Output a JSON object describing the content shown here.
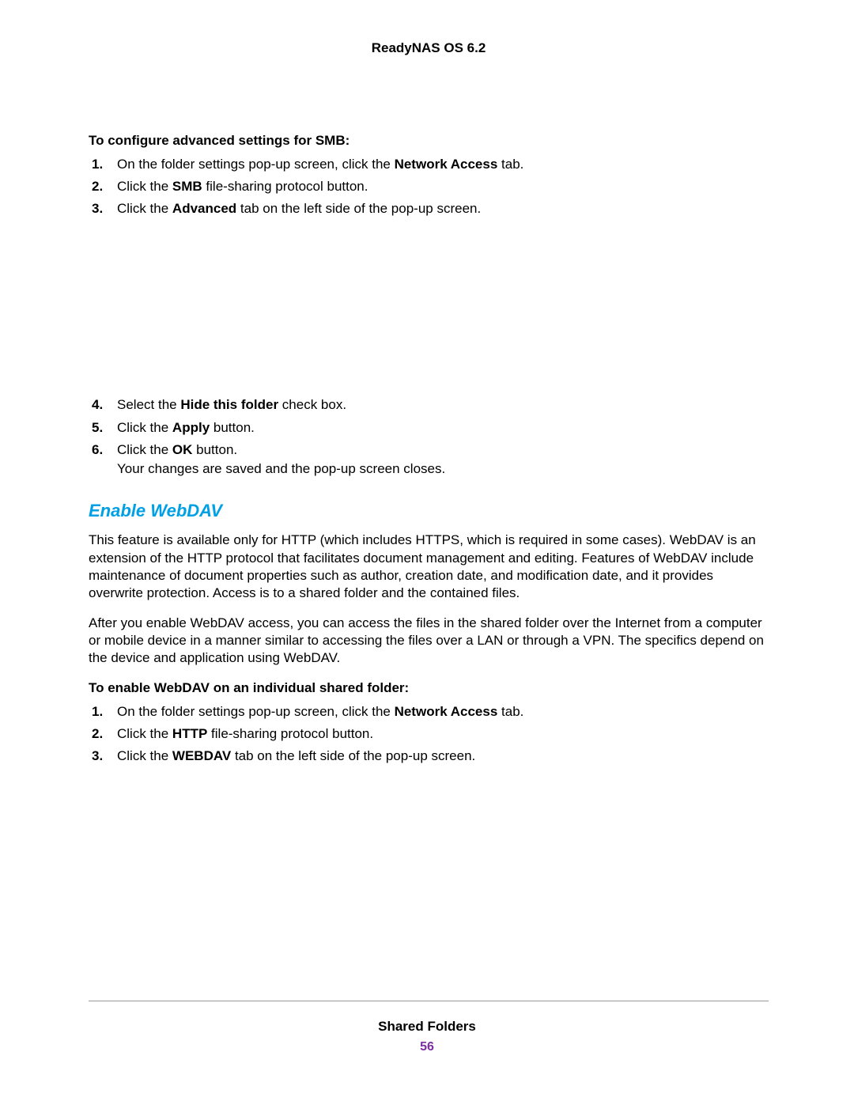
{
  "header": {
    "title": "ReadyNAS OS 6.2"
  },
  "section1": {
    "lead": "To configure advanced settings for SMB:",
    "items_a": [
      {
        "num": "1.",
        "pre": "On the folder settings pop-up screen, click the ",
        "bold": "Network Access",
        "post": " tab."
      },
      {
        "num": "2.",
        "pre": "Click the ",
        "bold": "SMB",
        "post": " file-sharing protocol button."
      },
      {
        "num": "3.",
        "pre": "Click the ",
        "bold": "Advanced",
        "post": " tab on the left side of the pop-up screen."
      }
    ],
    "items_b": [
      {
        "num": "4.",
        "pre": "Select the ",
        "bold": "Hide this folder",
        "post": " check box."
      },
      {
        "num": "5.",
        "pre": "Click the ",
        "bold": "Apply",
        "post": " button."
      },
      {
        "num": "6.",
        "pre": "Click the ",
        "bold": "OK",
        "post": " button.",
        "sub": "Your changes are saved and the pop-up screen closes."
      }
    ]
  },
  "section2": {
    "heading": "Enable WebDAV",
    "para1": "This feature is available only for HTTP (which includes HTTPS, which is required in some cases). WebDAV is an extension of the HTTP protocol that facilitates document management and editing. Features of WebDAV include maintenance of document properties such as author, creation date, and modification date, and it provides overwrite protection. Access is to a shared folder and the contained files.",
    "para2": "After you enable WebDAV access, you can access the files in the shared folder over the Internet from a computer or mobile device in a manner similar to accessing the files over a LAN or through a VPN. The specifics depend on the device and application using WebDAV.",
    "lead": "To enable WebDAV on an individual shared folder:",
    "items": [
      {
        "num": "1.",
        "pre": "On the folder settings pop-up screen, click the ",
        "bold": "Network Access",
        "post": " tab."
      },
      {
        "num": "2.",
        "pre": "Click the ",
        "bold": "HTTP",
        "post": " file-sharing protocol button."
      },
      {
        "num": "3.",
        "pre": "Click the ",
        "bold": "WEBDAV",
        "post": " tab on the left side of the pop-up screen."
      }
    ]
  },
  "footer": {
    "title": "Shared Folders",
    "page": "56"
  }
}
